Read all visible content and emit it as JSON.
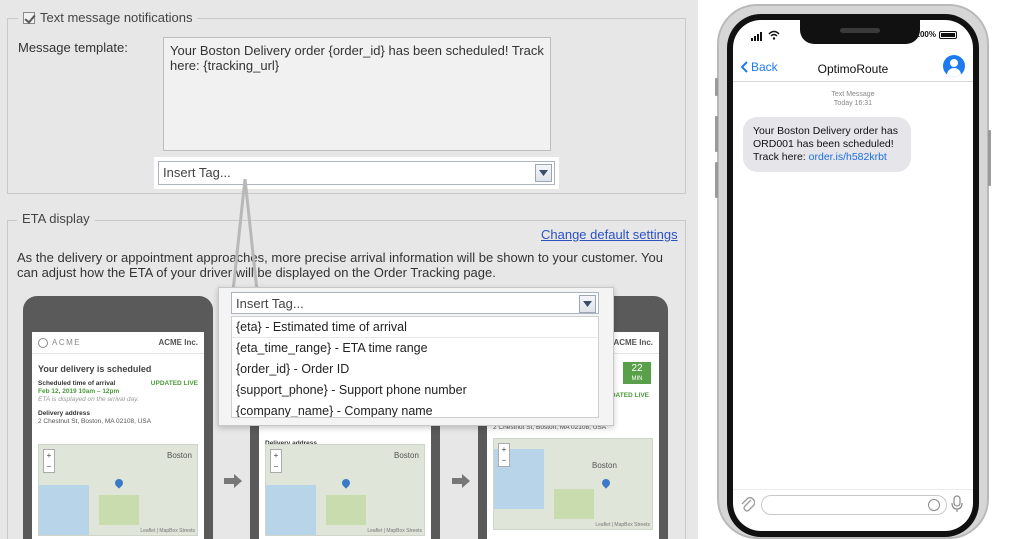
{
  "settings": {
    "sms_section": {
      "legend": "Text message notifications",
      "checkbox_checked": true,
      "template_label": "Message template:",
      "template_value": "Your Boston Delivery order {order_id} has been scheduled! Track here: {tracking_url}",
      "insert_tag_placeholder": "Insert Tag..."
    },
    "eta_section": {
      "legend": "ETA display",
      "change_link": "Change default settings",
      "description": "As the delivery or appointment approaches, more precise arrival information will be shown to your customer. You can adjust how the ETA of your driver will be displayed on the Order Tracking page."
    },
    "preview_phones": {
      "brand": "ACME",
      "company": "ACME Inc.",
      "heading": "Your delivery is scheduled",
      "scheduled_label": "Scheduled time of arrival",
      "scheduled_value": "Feb 12, 2019  10am – 12pm",
      "updated_live": "UPDATED LIVE",
      "eta_note": "ETA is displayed on the arrival day.",
      "address_label": "Delivery address",
      "address_value": "2 Chestnut St, Boston, MA 02108, USA",
      "map_city": "Boston",
      "map_attrib": "Leaflet | MapBox Streets",
      "eta_badge_value": "22",
      "eta_badge_unit": "MIN"
    },
    "tag_dropdown": {
      "placeholder": "Insert Tag...",
      "options": [
        "{eta} - Estimated time of arrival",
        "{eta_time_range} - ETA time range",
        "{order_id} - Order ID",
        "{support_phone} - Support phone number",
        "{company_name} - Company name"
      ]
    }
  },
  "phone": {
    "status": {
      "battery": "100%"
    },
    "nav": {
      "back_label": "Back",
      "contact": "OptimoRoute"
    },
    "message_meta": {
      "type": "Text Message",
      "time": "Today 16:31"
    },
    "message": {
      "text_before_link": "Your Boston Delivery order has ORD001 has been scheduled! Track here: ",
      "link": "order.is/h582krbt"
    }
  },
  "colors": {
    "link_blue": "#2b51c4",
    "ios_blue": "#1c7bf0",
    "panel_bg": "#e7e7e7",
    "eta_green": "#5aa04a"
  }
}
